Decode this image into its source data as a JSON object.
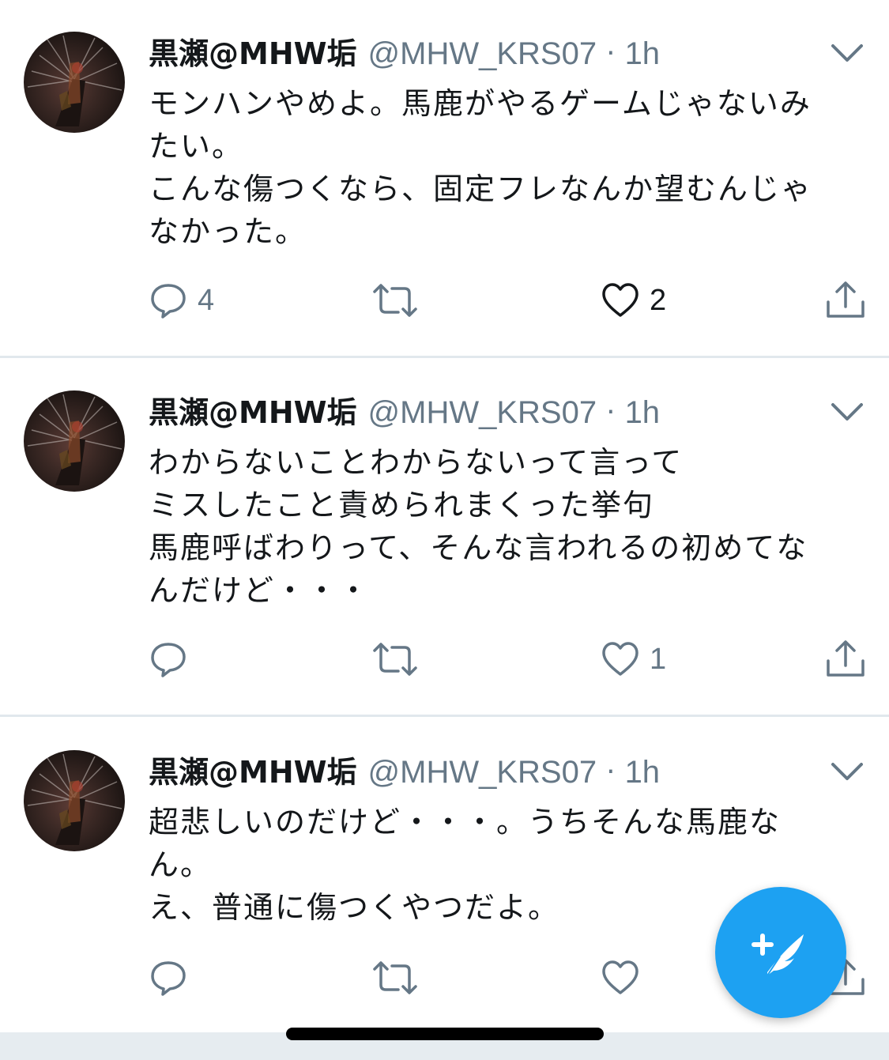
{
  "tweets": [
    {
      "name": "黒瀬@MHW垢",
      "handle": "@MHW_KRS07",
      "separator": "·",
      "time": "1h",
      "lines": [
        "モンハンやめよ。馬鹿がやるゲームじゃないみ",
        "たい。",
        "こんな傷つくなら、固定フレなんか望むんじゃ",
        "なかった。"
      ],
      "reply_count": "4",
      "like_count": "2"
    },
    {
      "name": "黒瀬@MHW垢",
      "handle": "@MHW_KRS07",
      "separator": "·",
      "time": "1h",
      "lines": [
        "わからないことわからないって言って",
        "ミスしたこと責められまくった挙句",
        "馬鹿呼ばわりって、そんな言われるの初めてな",
        "んだけど・・・"
      ],
      "reply_count": "",
      "like_count": "1"
    },
    {
      "name": "黒瀬@MHW垢",
      "handle": "@MHW_KRS07",
      "separator": "·",
      "time": "1h",
      "lines": [
        "超悲しいのだけど・・・。うちそんな馬鹿な",
        "ん。",
        "え、普通に傷つくやつだよ。"
      ],
      "reply_count": "",
      "like_count": ""
    }
  ],
  "icons": {
    "reply": "reply-bubble-icon",
    "retweet": "retweet-icon",
    "like": "heart-icon",
    "share": "share-icon",
    "more": "chevron-down-icon",
    "compose": "compose-feather-icon"
  },
  "colors": {
    "text": "#14171a",
    "secondary": "#657786",
    "divider": "#e1e8ed",
    "accent": "#1da1f2"
  }
}
